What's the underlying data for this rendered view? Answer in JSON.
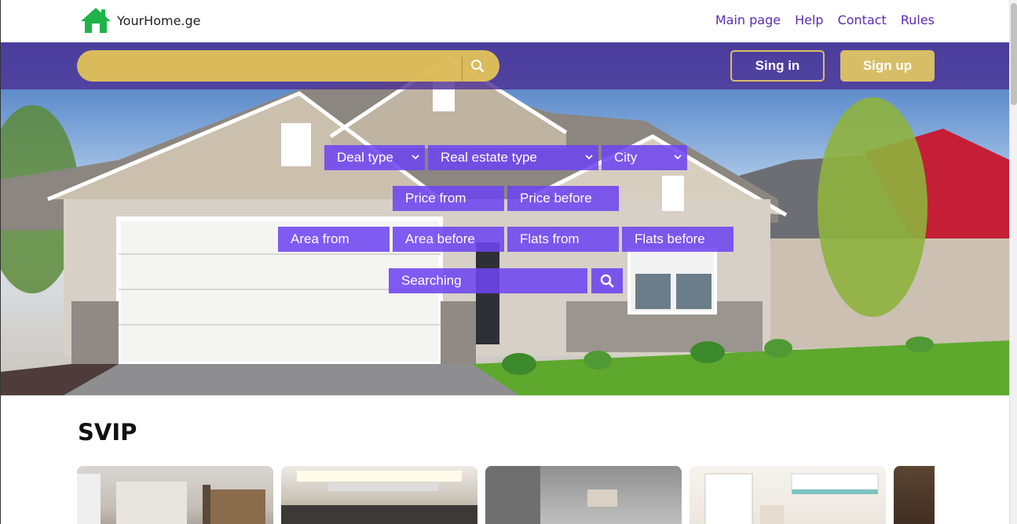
{
  "brand": {
    "name": "YourHome.ge",
    "icon": "house-icon",
    "icon_color": "#1fb34a"
  },
  "nav": {
    "items": [
      "Main page",
      "Help",
      "Contact",
      "Rules"
    ],
    "color": "#5b2bb5"
  },
  "header": {
    "search_placeholder": "",
    "search_icon": "search-icon",
    "signin_label": "Sing in",
    "signup_label": "Sign up"
  },
  "filters": {
    "deal_type": "Deal type",
    "real_estate_type": "Real estate type",
    "city": "City",
    "price_from": "Price from",
    "price_before": "Price before",
    "area_from": "Area from",
    "area_before": "Area before",
    "flats_from": "Flats from",
    "flats_before": "Flats before",
    "searching": "Searching"
  },
  "svip": {
    "title": "SVIP"
  },
  "colors": {
    "accent_purple": "#6e46f0",
    "gold": "#d8bd67",
    "strip": "#4e3296"
  }
}
